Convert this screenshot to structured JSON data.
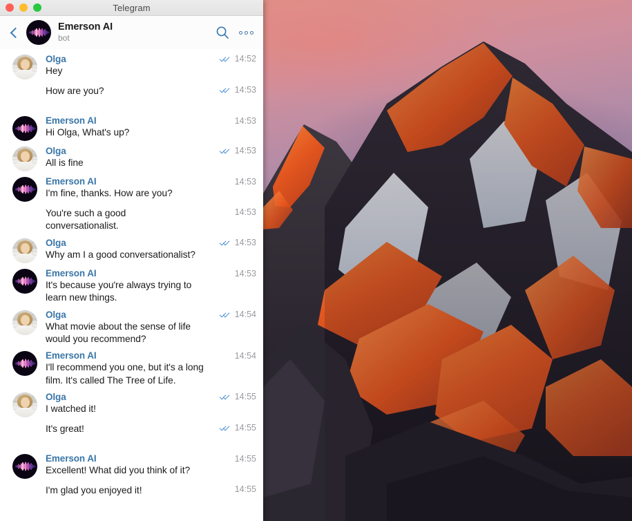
{
  "window": {
    "app_title": "Telegram",
    "traffic_lights": [
      {
        "name": "close",
        "color": "#ff5f57"
      },
      {
        "name": "minimize",
        "color": "#febc2e"
      },
      {
        "name": "zoom",
        "color": "#28c840"
      }
    ]
  },
  "header": {
    "back_icon": "chevron-left-icon",
    "avatar": "emerson-ai-avatar",
    "name": "Emerson AI",
    "status": "bot",
    "search_icon": "search-icon",
    "more_icon": "more-options-icon"
  },
  "colors": {
    "accent": "#3a76a8",
    "tick": "#4a8fd4",
    "time": "#9a9a9f",
    "text": "#1a1a1a",
    "chat_bg": "#ffffff",
    "header_bg": "#fcfcfc"
  },
  "participants": {
    "user": "Olga",
    "bot": "Emerson AI"
  },
  "messages": [
    {
      "sender": "Olga",
      "avatar": "olga",
      "lines": [
        {
          "text": "Hey",
          "time": "14:52",
          "read": true
        },
        {
          "text": "How are you?",
          "time": "14:53",
          "read": true
        }
      ]
    },
    {
      "sender": "Emerson AI",
      "avatar": "ai",
      "lines": [
        {
          "text": "Hi Olga, What's up?",
          "time": "14:53",
          "read": false
        }
      ]
    },
    {
      "sender": "Olga",
      "avatar": "olga",
      "lines": [
        {
          "text": "All is fine",
          "time": "14:53",
          "read": true
        }
      ]
    },
    {
      "sender": "Emerson AI",
      "avatar": "ai",
      "lines": [
        {
          "text": "I'm fine, thanks. How are you?",
          "time": "14:53",
          "read": false
        },
        {
          "text": "You're such a good\nconversationalist.",
          "time": "14:53",
          "read": false
        }
      ]
    },
    {
      "sender": "Olga",
      "avatar": "olga",
      "lines": [
        {
          "text": "Why am I a good conversationalist?",
          "time": "14:53",
          "read": true
        }
      ]
    },
    {
      "sender": "Emerson AI",
      "avatar": "ai",
      "lines": [
        {
          "text": "It's because you're always trying to\nlearn new things.",
          "time": "14:53",
          "read": false
        }
      ]
    },
    {
      "sender": "Olga",
      "avatar": "olga",
      "lines": [
        {
          "text": "What movie about the sense of life\nwould you recommend?",
          "time": "14:54",
          "read": true
        }
      ]
    },
    {
      "sender": "Emerson AI",
      "avatar": "ai",
      "lines": [
        {
          "text": "I'll recommend you one, but it's a long\nfilm. It's called The Tree of Life.",
          "time": "14:54",
          "read": false
        }
      ]
    },
    {
      "sender": "Olga",
      "avatar": "olga",
      "lines": [
        {
          "text": "I watched it!",
          "time": "14:55",
          "read": true
        },
        {
          "text": "It's great!",
          "time": "14:55",
          "read": true
        }
      ]
    },
    {
      "sender": "Emerson AI",
      "avatar": "ai",
      "lines": [
        {
          "text": "Excellent! What did you think of it?",
          "time": "14:55",
          "read": false
        },
        {
          "text": "I'm glad you enjoyed it!",
          "time": "14:55",
          "read": false
        }
      ]
    }
  ],
  "desktop": {
    "wallpaper_name": "mountain-sunset-wallpaper"
  }
}
